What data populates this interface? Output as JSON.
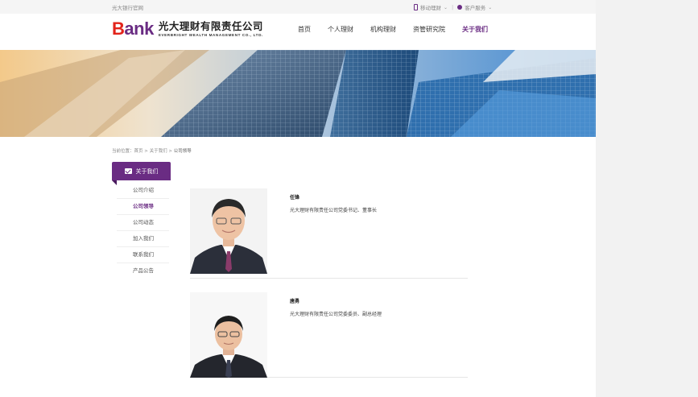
{
  "topbar": {
    "official_site": "光大银行官网",
    "mobile": "移动理财",
    "service": "客户服务"
  },
  "logo": {
    "mark_b": "B",
    "mark_ank": "ank",
    "cn": "光大理财有限责任公司",
    "en": "EVERBRIGHT WEALTH MANAGEMENT CO., LTD."
  },
  "nav": [
    "首页",
    "个人理财",
    "机构理财",
    "资管研究院",
    "关于我们"
  ],
  "breadcrumb": {
    "prefix": "当前位置：",
    "home": "首页",
    "sep": " > ",
    "section": "关于我们",
    "current": "公司领导"
  },
  "sidebar": {
    "title": "关于我们",
    "items": [
      "公司介绍",
      "公司领导",
      "公司动态",
      "加入我们",
      "联系我们",
      "产品公告"
    ],
    "active_index": 1
  },
  "leaders": [
    {
      "name": "任锋",
      "title": "光大理财有限责任公司党委书记、董事长"
    },
    {
      "name": "唐勇",
      "title": "光大理财有限责任公司党委委员、副总经理"
    }
  ],
  "colors": {
    "brand_purple": "#6a2c83",
    "brand_red": "#e2231a"
  }
}
